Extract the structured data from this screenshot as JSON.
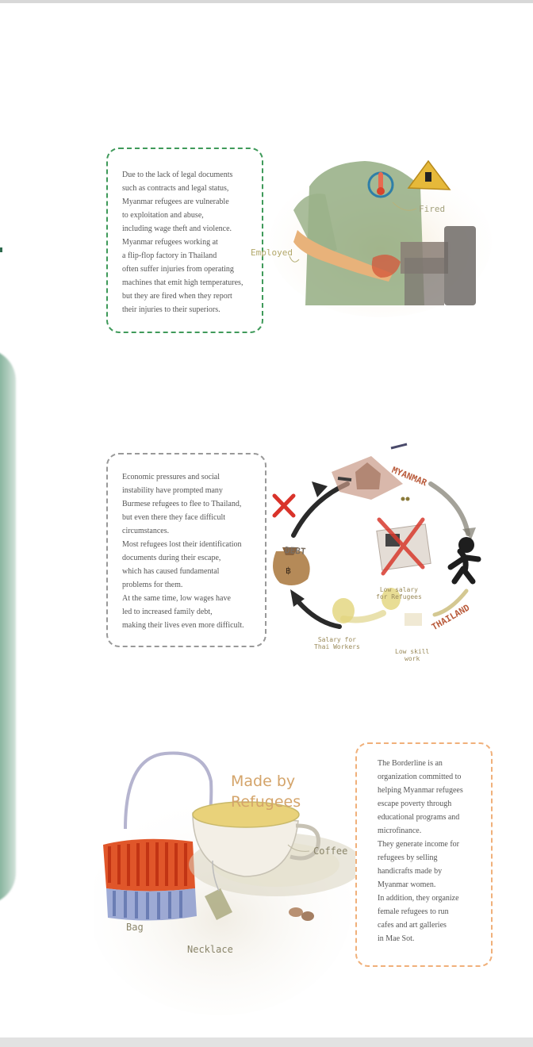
{
  "card1": {
    "lines": [
      "Due to the lack of legal documents",
      "such as contracts and legal status,",
      "Myanmar refugees are vulnerable",
      "to exploitation and abuse,",
      "including wage theft and violence.",
      "Myanmar refugees working at",
      "a flip-flop factory in Thailand",
      "often suffer injuries from operating",
      "machines that emit high temperatures,",
      "but they are fired when they report",
      "their injuries to their superiors."
    ]
  },
  "factory_illustration": {
    "label_employed": "Employed",
    "label_fired": "Fired"
  },
  "card2": {
    "lines": [
      "Economic pressures and social",
      "instability have prompted many",
      "Burmese refugees to flee to Thailand,",
      "but even there they face difficult",
      "circumstances.",
      "Most refugees lost their identification",
      "documents during their escape,",
      "which has caused fundamental",
      "problems for them.",
      "At the same time, low wages have",
      "led to increased family debt,",
      "making their lives even more difficult."
    ]
  },
  "cycle_illustration": {
    "label_myanmar": "MYANMAR",
    "label_thailand": "THAILAND",
    "label_debt": "DEBT",
    "label_low_salary_refugees": [
      "Low salary",
      "for Refugees"
    ],
    "label_salary_thai": [
      "Salary for",
      "Thai Workers"
    ],
    "label_low_skill": [
      "Low skill",
      "work"
    ]
  },
  "products_illustration": {
    "title_line1": "Made by",
    "title_line2": "Refugees",
    "label_coffee": "Coffee",
    "label_bag": "Bag",
    "label_necklace": "Necklace"
  },
  "card3": {
    "lines": [
      "The Borderline is an",
      "organization committed to",
      "helping Myanmar refugees",
      "escape poverty through",
      "educational programs and",
      "microfinance.",
      "They generate income for",
      "refugees by selling",
      "handicrafts made by",
      "Myanmar women.",
      "In addition, they organize",
      "female refugees to run",
      "cafes and art galleries",
      "in Mae Sot."
    ]
  }
}
